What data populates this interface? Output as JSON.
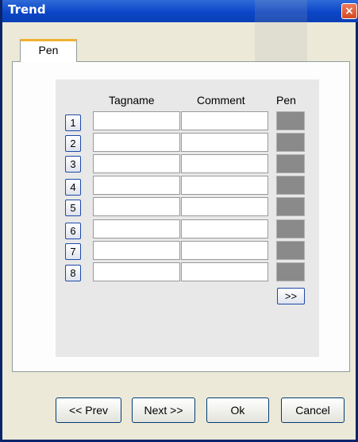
{
  "window": {
    "title": "Trend",
    "close_glyph": "×"
  },
  "tabs": [
    {
      "label": "Pen",
      "active": true
    }
  ],
  "table": {
    "headers": {
      "tagname": "Tagname",
      "comment": "Comment",
      "pen": "Pen"
    },
    "rows": [
      {
        "number": "1",
        "tagname": "",
        "comment": ""
      },
      {
        "number": "2",
        "tagname": "",
        "comment": ""
      },
      {
        "number": "3",
        "tagname": "",
        "comment": ""
      },
      {
        "number": "4",
        "tagname": "",
        "comment": ""
      },
      {
        "number": "5",
        "tagname": "",
        "comment": ""
      },
      {
        "number": "6",
        "tagname": "",
        "comment": ""
      },
      {
        "number": "7",
        "tagname": "",
        "comment": ""
      },
      {
        "number": "8",
        "tagname": "",
        "comment": ""
      }
    ],
    "more_label": ">>"
  },
  "buttons": {
    "prev": "<< Prev",
    "next": "Next >>",
    "ok": "Ok",
    "cancel": "Cancel"
  },
  "colors": {
    "titlebar": "#0b46c8",
    "pen_swatch": "#8a8a8a",
    "tab_accent": "#f0b030"
  }
}
